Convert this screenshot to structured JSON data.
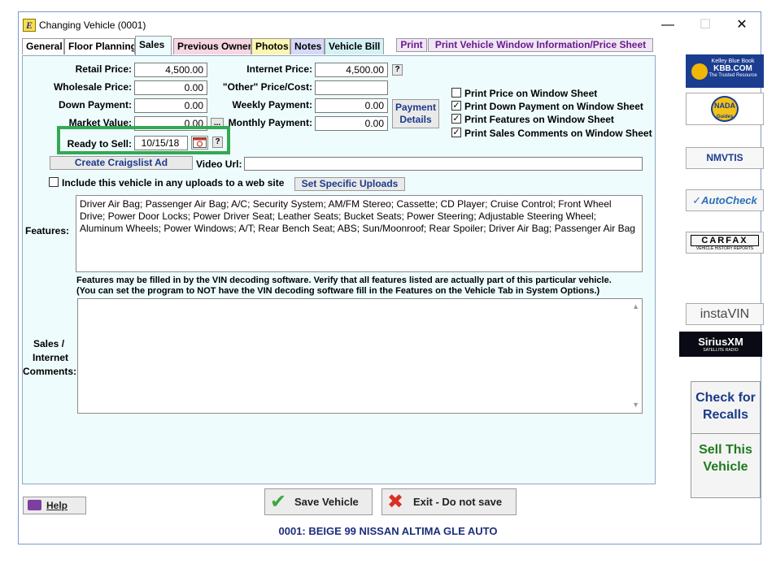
{
  "window": {
    "title": "Changing Vehicle  (0001)",
    "app_icon_letter": "E",
    "minimize": "—",
    "maximize": "☐",
    "close": "✕"
  },
  "tabs": [
    {
      "label": "General",
      "color": "#ffffff"
    },
    {
      "label": "Floor Planning",
      "color": "#ffffff"
    },
    {
      "label": "Sales",
      "color": "#eefcfd"
    },
    {
      "label": "Previous Owner",
      "color": "#f7d5e1"
    },
    {
      "label": "Photos",
      "color": "#fbf6b0"
    },
    {
      "label": "Notes",
      "color": "#d6d8f7"
    },
    {
      "label": "Vehicle Bill",
      "color": "#d4f1f4"
    }
  ],
  "print_buttons": {
    "print": "Print",
    "print_window": "Print Vehicle Window Information/Price Sheet"
  },
  "prices": {
    "retail_label": "Retail Price:",
    "retail_value": "4,500.00",
    "wholesale_label": "Wholesale Price:",
    "wholesale_value": "0.00",
    "down_label": "Down Payment:",
    "down_value": "0.00",
    "market_label": "Market Value:",
    "market_value": "0.00",
    "market_btn": "...",
    "internet_label": "Internet Price:",
    "internet_value": "4,500.00",
    "internet_help": "?",
    "other_label": "\"Other\" Price/Cost:",
    "other_value": "",
    "weekly_label": "Weekly Payment:",
    "weekly_value": "0.00",
    "monthly_label": "Monthly Payment:",
    "monthly_value": "0.00",
    "payment_details": "Payment Details"
  },
  "ready": {
    "label": "Ready to Sell:",
    "value": "10/15/18",
    "help": "?"
  },
  "checkboxes": [
    {
      "label": "Print Price on Window Sheet",
      "checked": ""
    },
    {
      "label": "Print Down Payment on Window Sheet",
      "checked": "✓"
    },
    {
      "label": "Print Features on Window Sheet",
      "checked": "✓"
    },
    {
      "label": "Print Sales Comments on Window Sheet",
      "checked": "✓"
    }
  ],
  "craigslist": {
    "button": "Create Craigslist Ad",
    "video_label": "Video Url:",
    "video_value": ""
  },
  "uploads": {
    "include_label": "Include this vehicle in any uploads to a web site",
    "include_checked": "",
    "set_specific": "Set Specific Uploads"
  },
  "features": {
    "label": "Features:",
    "text": "Driver Air Bag; Passenger Air Bag; A/C; Security System; AM/FM Stereo; Cassette; CD Player; Cruise Control; Front Wheel Drive; Power Door Locks; Power Driver Seat; Leather Seats; Bucket Seats; Power Steering; Adjustable Steering Wheel; Aluminum Wheels; Power Windows; A/T; Rear Bench Seat; ABS; Sun/Moonroof; Rear Spoiler; Driver Air Bag; Passenger Air Bag",
    "note1": "Features may be filled in by the VIN decoding software.  Verify that all features listed are actually part of this particular vehicle.",
    "note2": "(You can set the program to NOT have the VIN decoding software  fill in the Features on the Vehicle Tab in System Options.)"
  },
  "comments": {
    "label_1": "Sales /",
    "label_2": "Internet",
    "label_3": "Comments:",
    "value": ""
  },
  "side": {
    "kbb_top": "Kelley Blue Book",
    "kbb_main": "KBB.COM",
    "kbb_sub": "The Trusted Resource",
    "nada": "NADA",
    "nada_sub": "Guides",
    "nmvtis": "NMVTIS",
    "autocheck": "AutoCheck",
    "carfax": "CARFAX",
    "carfax_sub": "VEHICLE HISTORY REPORTS",
    "instavin": "instaVIN",
    "siriusxm": "SiriusXM",
    "siriusxm_sub": "SATELLITE RADIO",
    "recalls_1": "Check for",
    "recalls_2": "Recalls",
    "sell_1": "Sell This",
    "sell_2": "Vehicle"
  },
  "footer": {
    "help": "Help",
    "save": "Save Vehicle",
    "exit": "Exit - Do not save",
    "status": "0001: BEIGE 99 NISSAN ALTIMA GLE AUTO"
  },
  "colors": {
    "panel_bg": "#eefcfd",
    "link_blue": "#1b3a8a",
    "recalls_blue": "#1b3a8a",
    "sell_green": "#1f7a1f",
    "highlight": "#34a853"
  }
}
